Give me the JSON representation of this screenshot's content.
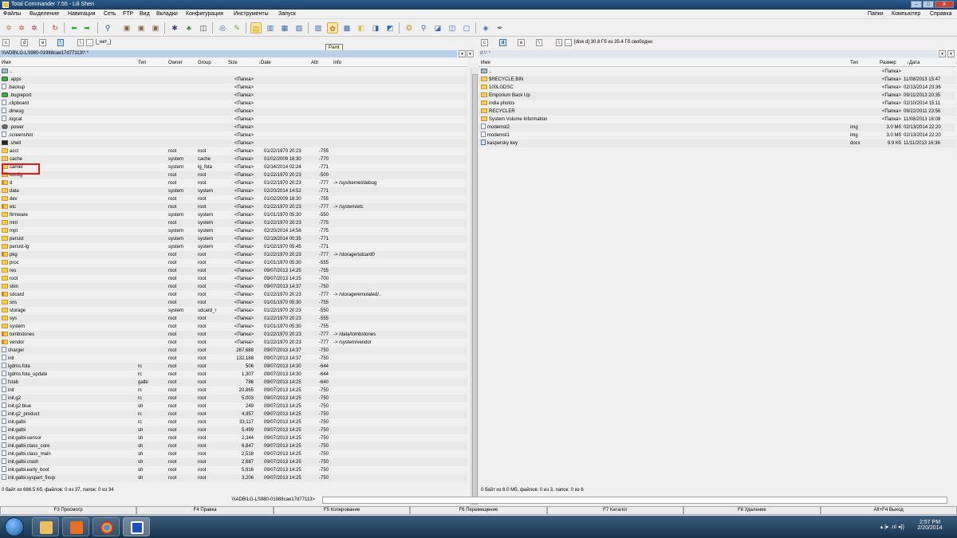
{
  "window": {
    "title": "Total Commander 7.55 - Lili Shen"
  },
  "window_buttons": {
    "minimize": "–",
    "maximize": "□",
    "close": "X"
  },
  "menu": {
    "left": [
      "Файлы",
      "Выделение",
      "Навигация",
      "Сеть",
      "FTP",
      "Вид",
      "Вкладки",
      "Конфигурация",
      "Инструменты",
      "Запуск"
    ],
    "right": [
      "Папки",
      "Компьютер",
      "Справка"
    ]
  },
  "tooltip": "Paint",
  "left_panel": {
    "drives": [
      "c",
      "d",
      "e",
      "\\",
      "..",
      "[_нет_]"
    ],
    "path": "\\\\\\ADB\\LG-LS980-01988cae17d77113\\*.*",
    "columns": {
      "name": "Имя",
      "type": "Тип",
      "owner": "Owner",
      "group": "Group",
      "size": "Size",
      "date": "↓Date",
      "attr": "Attr",
      "info": "Info"
    },
    "rows": [
      {
        "name": "..",
        "type": "",
        "owner": "",
        "group": "",
        "size": "",
        "date": "",
        "attr": "",
        "info": "",
        "icon": "up"
      },
      {
        "name": ".apps",
        "type": "",
        "owner": "",
        "group": "",
        "size": "<Папка>",
        "date": "",
        "attr": "",
        "info": "",
        "icon": "apps"
      },
      {
        "name": ".backup",
        "type": "",
        "owner": "",
        "group": "",
        "size": "<Папка>",
        "date": "",
        "attr": "",
        "info": "",
        "icon": "file"
      },
      {
        "name": ".bugreport",
        "type": "",
        "owner": "",
        "group": "",
        "size": "<Папка>",
        "date": "",
        "attr": "",
        "info": "",
        "icon": "apps"
      },
      {
        "name": ".clipboard",
        "type": "",
        "owner": "",
        "group": "",
        "size": "<Папка>",
        "date": "",
        "attr": "",
        "info": "",
        "icon": "file"
      },
      {
        "name": ".dmesg",
        "type": "",
        "owner": "",
        "group": "",
        "size": "<Папка>",
        "date": "",
        "attr": "",
        "info": "",
        "icon": "file"
      },
      {
        "name": ".logcat",
        "type": "",
        "owner": "",
        "group": "",
        "size": "<Папка>",
        "date": "",
        "attr": "",
        "info": "",
        "icon": "file"
      },
      {
        "name": ".power",
        "type": "",
        "owner": "",
        "group": "",
        "size": "<Папка>",
        "date": "",
        "attr": "",
        "info": "",
        "icon": "gear"
      },
      {
        "name": ".screenshot",
        "type": "",
        "owner": "",
        "group": "",
        "size": "<Папка>",
        "date": "",
        "attr": "",
        "info": "",
        "icon": "file"
      },
      {
        "name": ".shell",
        "type": "",
        "owner": "",
        "group": "",
        "size": "<Папка>",
        "date": "",
        "attr": "",
        "info": "",
        "icon": "monitor"
      },
      {
        "name": "acct",
        "type": "",
        "owner": "root",
        "group": "root",
        "size": "<Папка>",
        "date": "01/22/1970 20:23",
        "attr": "-755",
        "info": "",
        "icon": "folder"
      },
      {
        "name": "cache",
        "type": "",
        "owner": "system",
        "group": "cache",
        "size": "<Папка>",
        "date": "01/02/2009 18:30",
        "attr": "-770",
        "info": "",
        "icon": "folder"
      },
      {
        "name": "carrier",
        "type": "",
        "owner": "system",
        "group": "lg_fota",
        "size": "<Папка>",
        "date": "02/14/2014 02:24",
        "attr": "-771",
        "info": "",
        "icon": "folder"
      },
      {
        "name": "config",
        "type": "",
        "owner": "root",
        "group": "root",
        "size": "<Папка>",
        "date": "01/22/1970 20:23",
        "attr": "-500",
        "info": "",
        "icon": "folder"
      },
      {
        "name": "d",
        "type": "",
        "owner": "root",
        "group": "root",
        "size": "<Папка>",
        "date": "01/22/1970 20:23",
        "attr": "-777",
        "info": "-> /sys/kernel/debug",
        "icon": "link"
      },
      {
        "name": "data",
        "type": "",
        "owner": "system",
        "group": "system",
        "size": "<Папка>",
        "date": "02/20/2014 14:52",
        "attr": "-771",
        "info": "",
        "icon": "folder"
      },
      {
        "name": "dev",
        "type": "",
        "owner": "root",
        "group": "root",
        "size": "<Папка>",
        "date": "01/02/2009 18:30",
        "attr": "-755",
        "info": "",
        "icon": "folder"
      },
      {
        "name": "etc",
        "type": "",
        "owner": "root",
        "group": "root",
        "size": "<Папка>",
        "date": "01/22/1970 20:23",
        "attr": "-777",
        "info": "-> /system/etc",
        "icon": "link"
      },
      {
        "name": "firmware",
        "type": "",
        "owner": "system",
        "group": "system",
        "size": "<Папка>",
        "date": "01/01/1970 05:30",
        "attr": "-550",
        "info": "",
        "icon": "folder"
      },
      {
        "name": "mnt",
        "type": "",
        "owner": "root",
        "group": "system",
        "size": "<Папка>",
        "date": "01/22/1970 20:23",
        "attr": "-775",
        "info": "",
        "icon": "folder"
      },
      {
        "name": "mpt",
        "type": "",
        "owner": "system",
        "group": "system",
        "size": "<Папка>",
        "date": "02/20/2014 14:56",
        "attr": "-775",
        "info": "",
        "icon": "folder"
      },
      {
        "name": "persist",
        "type": "",
        "owner": "system",
        "group": "system",
        "size": "<Папка>",
        "date": "02/19/2014 00:35",
        "attr": "-771",
        "info": "",
        "icon": "folder"
      },
      {
        "name": "persist-lg",
        "type": "",
        "owner": "system",
        "group": "system",
        "size": "<Папка>",
        "date": "01/02/1970 05:45",
        "attr": "-771",
        "info": "",
        "icon": "folder"
      },
      {
        "name": "pkg",
        "type": "",
        "owner": "root",
        "group": "root",
        "size": "<Папка>",
        "date": "01/22/1970 20:23",
        "attr": "-777",
        "info": "-> /storage/sdcard0",
        "icon": "link"
      },
      {
        "name": "proc",
        "type": "",
        "owner": "root",
        "group": "root",
        "size": "<Папка>",
        "date": "01/01/1970 05:30",
        "attr": "-555",
        "info": "",
        "icon": "folder"
      },
      {
        "name": "res",
        "type": "",
        "owner": "root",
        "group": "root",
        "size": "<Папка>",
        "date": "09/07/2013 14:25",
        "attr": "-755",
        "info": "",
        "icon": "folder"
      },
      {
        "name": "root",
        "type": "",
        "owner": "root",
        "group": "root",
        "size": "<Папка>",
        "date": "09/07/2013 14:25",
        "attr": "-700",
        "info": "",
        "icon": "folder"
      },
      {
        "name": "sbin",
        "type": "",
        "owner": "root",
        "group": "root",
        "size": "<Папка>",
        "date": "09/07/2013 14:37",
        "attr": "-750",
        "info": "",
        "icon": "folder"
      },
      {
        "name": "sdcard",
        "type": "",
        "owner": "root",
        "group": "root",
        "size": "<Папка>",
        "date": "01/22/1970 20:23",
        "attr": "-777",
        "info": "-> /storage/emulated/..",
        "icon": "link"
      },
      {
        "name": "sns",
        "type": "",
        "owner": "root",
        "group": "root",
        "size": "<Папка>",
        "date": "01/01/1970 05:30",
        "attr": "-755",
        "info": "",
        "icon": "folder"
      },
      {
        "name": "storage",
        "type": "",
        "owner": "system",
        "group": "sdcard_r",
        "size": "<Папка>",
        "date": "01/22/1970 20:23",
        "attr": "-550",
        "info": "",
        "icon": "folder"
      },
      {
        "name": "sys",
        "type": "",
        "owner": "root",
        "group": "root",
        "size": "<Папка>",
        "date": "01/22/1970 20:23",
        "attr": "-555",
        "info": "",
        "icon": "folder"
      },
      {
        "name": "system",
        "type": "",
        "owner": "root",
        "group": "root",
        "size": "<Папка>",
        "date": "01/01/1970 05:30",
        "attr": "-755",
        "info": "",
        "icon": "folder"
      },
      {
        "name": "tombstones",
        "type": "",
        "owner": "root",
        "group": "root",
        "size": "<Папка>",
        "date": "01/22/1970 20:23",
        "attr": "-777",
        "info": "-> /data/tombstones",
        "icon": "link"
      },
      {
        "name": "vendor",
        "type": "",
        "owner": "root",
        "group": "root",
        "size": "<Папка>",
        "date": "01/22/1970 20:23",
        "attr": "-777",
        "info": "-> /system/vendor",
        "icon": "link"
      },
      {
        "name": "charger",
        "type": "",
        "owner": "root",
        "group": "root",
        "size": "267,688",
        "date": "09/07/2013 14:37",
        "attr": "-750",
        "info": "",
        "icon": "file"
      },
      {
        "name": "init",
        "type": "",
        "owner": "root",
        "group": "root",
        "size": "132,188",
        "date": "09/07/2013 14:37",
        "attr": "-750",
        "info": "",
        "icon": "file"
      },
      {
        "name": "lgdms.fota",
        "type": "rc",
        "owner": "root",
        "group": "root",
        "size": "506",
        "date": "09/07/2013 14:30",
        "attr": "-644",
        "info": "",
        "icon": "file"
      },
      {
        "name": "lgdms.fota_update",
        "type": "rc",
        "owner": "root",
        "group": "root",
        "size": "1,307",
        "date": "09/07/2013 14:30",
        "attr": "-644",
        "info": "",
        "icon": "file"
      },
      {
        "name": "fstab",
        "type": "galbi",
        "owner": "root",
        "group": "root",
        "size": "786",
        "date": "09/07/2013 14:25",
        "attr": "-640",
        "info": "",
        "icon": "file"
      },
      {
        "name": "init",
        "type": "rc",
        "owner": "root",
        "group": "root",
        "size": "20,865",
        "date": "09/07/2013 14:25",
        "attr": "-750",
        "info": "",
        "icon": "file"
      },
      {
        "name": "init.g2",
        "type": "rc",
        "owner": "root",
        "group": "root",
        "size": "5,003",
        "date": "09/07/2013 14:25",
        "attr": "-750",
        "info": "",
        "icon": "file"
      },
      {
        "name": "init.g2.blue",
        "type": "sh",
        "owner": "root",
        "group": "root",
        "size": "249",
        "date": "09/07/2013 14:25",
        "attr": "-750",
        "info": "",
        "icon": "file"
      },
      {
        "name": "init.g2_product",
        "type": "rc",
        "owner": "root",
        "group": "root",
        "size": "4,957",
        "date": "09/07/2013 14:25",
        "attr": "-750",
        "info": "",
        "icon": "file"
      },
      {
        "name": "init.galbi",
        "type": "rc",
        "owner": "root",
        "group": "root",
        "size": "33,117",
        "date": "09/07/2013 14:25",
        "attr": "-750",
        "info": "",
        "icon": "file"
      },
      {
        "name": "init.galbi",
        "type": "sh",
        "owner": "root",
        "group": "root",
        "size": "5,499",
        "date": "09/07/2013 14:25",
        "attr": "-750",
        "info": "",
        "icon": "file"
      },
      {
        "name": "init.galbi-sensor",
        "type": "sh",
        "owner": "root",
        "group": "root",
        "size": "2,344",
        "date": "09/07/2013 14:25",
        "attr": "-750",
        "info": "",
        "icon": "file"
      },
      {
        "name": "init.galbi.class_core",
        "type": "sh",
        "owner": "root",
        "group": "root",
        "size": "6,847",
        "date": "09/07/2013 14:25",
        "attr": "-750",
        "info": "",
        "icon": "file"
      },
      {
        "name": "init.galbi.class_main",
        "type": "sh",
        "owner": "root",
        "group": "root",
        "size": "2,518",
        "date": "09/07/2013 14:25",
        "attr": "-750",
        "info": "",
        "icon": "file"
      },
      {
        "name": "init.galbi.crash",
        "type": "sh",
        "owner": "root",
        "group": "root",
        "size": "2,687",
        "date": "09/07/2013 14:25",
        "attr": "-750",
        "info": "",
        "icon": "file"
      },
      {
        "name": "init.galbi.early_boot",
        "type": "sh",
        "owner": "root",
        "group": "root",
        "size": "5,916",
        "date": "09/07/2013 14:25",
        "attr": "-750",
        "info": "",
        "icon": "file"
      },
      {
        "name": "init.galbi.syspart_fixup",
        "type": "sh",
        "owner": "root",
        "group": "root",
        "size": "3,206",
        "date": "09/07/2013 14:25",
        "attr": "-750",
        "info": "",
        "icon": "file"
      }
    ],
    "status": "0 байт из 686.5 Кб, файлов: 0 из 37, папок: 0 из 34"
  },
  "right_panel": {
    "drives": [
      "c",
      "d",
      "e",
      "\\",
      ".."
    ],
    "free_info": "[disk d]  30.8 Гб из 35.4 Гб свободно",
    "path": "d:\\*.*",
    "columns": {
      "name": "Имя",
      "type": "Тип",
      "size": "Размер",
      "date": "↓Дата"
    },
    "rows": [
      {
        "name": "..",
        "type": "",
        "size": "<Папка>",
        "date": "",
        "icon": "up"
      },
      {
        "name": "$RECYCLE.BIN",
        "type": "",
        "size": "<Папка>",
        "date": "11/08/2013 15:47",
        "icon": "folder"
      },
      {
        "name": "100LGDSC",
        "type": "",
        "size": "<Папка>",
        "date": "02/13/2014 23:36",
        "icon": "folder"
      },
      {
        "name": "Emporium Back Up",
        "type": "",
        "size": "<Папка>",
        "date": "09/11/2013 20:35",
        "icon": "folder"
      },
      {
        "name": "india photos",
        "type": "",
        "size": "<Папка>",
        "date": "02/10/2014 15:11",
        "icon": "folder"
      },
      {
        "name": "RECYCLER",
        "type": "",
        "size": "<Папка>",
        "date": "09/22/2011 23:56",
        "icon": "folder"
      },
      {
        "name": "System Volume Information",
        "type": "",
        "size": "<Папка>",
        "date": "11/08/2013 16:08",
        "icon": "folder"
      },
      {
        "name": "modemst2",
        "type": "img",
        "size": "3.0 Мб",
        "date": "02/13/2014 22:20",
        "icon": "file"
      },
      {
        "name": "modemst1",
        "type": "img",
        "size": "3.0 Мб",
        "date": "02/13/2014 22:20",
        "icon": "file"
      },
      {
        "name": "kaspersky key",
        "type": "docx",
        "size": "9.9 Кб",
        "date": "11/11/2013 16:36",
        "icon": "doc"
      }
    ],
    "status": "0 байт из 6.0 Мб, файлов: 0 из 3, папок: 0 из 6"
  },
  "command_line": {
    "label": "\\\\\\ADB\\LG-LS980-01988cae17d77113>"
  },
  "function_keys": [
    "F3 Просмотр",
    "F4 Правка",
    "F5 Копирование",
    "F6 Перемещение",
    "F7 Каталог",
    "F8 Удаление",
    "Alt+F4 Выход"
  ],
  "taskbar": {
    "time": "2:57 PM",
    "date": "2/20/2014",
    "tray": "▴ |▸ .ııl ◂))"
  },
  "colors": {
    "selected_path": "#b9d1ea",
    "folder": "#f4cc5a",
    "highlight_box": "#e01818"
  }
}
